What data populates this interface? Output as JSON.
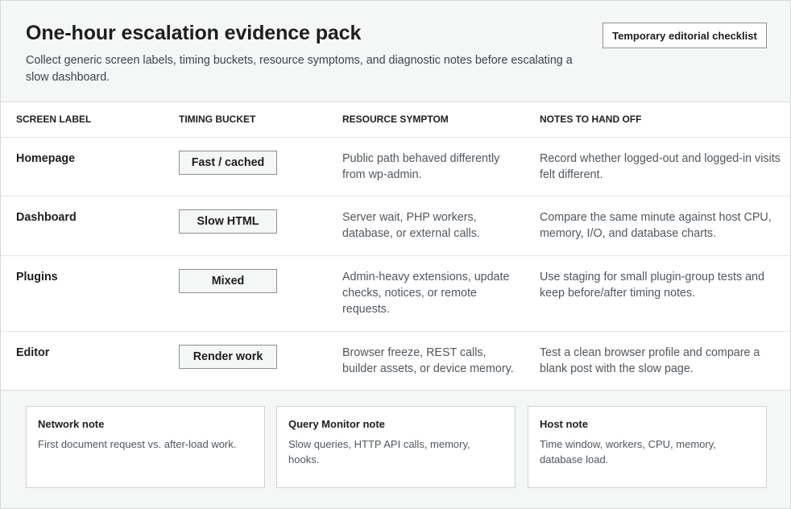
{
  "header": {
    "title": "One-hour escalation evidence pack",
    "subtitle": "Collect generic screen labels, timing buckets, resource symptoms, and diagnostic notes before escalating a slow dashboard.",
    "checklist_button": "Temporary editorial checklist"
  },
  "table": {
    "columns": [
      "SCREEN LABEL",
      "TIMING BUCKET",
      "RESOURCE SYMPTOM",
      "NOTES TO HAND OFF"
    ],
    "rows": [
      {
        "label": "Homepage",
        "bucket": "Fast / cached",
        "resource": "Public path behaved differently from wp-admin.",
        "notes": "Record whether logged-out and logged-in visits felt different."
      },
      {
        "label": "Dashboard",
        "bucket": "Slow HTML",
        "resource": "Server wait, PHP workers, database, or external calls.",
        "notes": "Compare the same minute against host CPU, memory, I/O, and database charts."
      },
      {
        "label": "Plugins",
        "bucket": "Mixed",
        "resource": "Admin-heavy extensions, update checks, notices, or remote requests.",
        "notes": "Use staging for small plugin-group tests and keep before/after timing notes."
      },
      {
        "label": "Editor",
        "bucket": "Render work",
        "resource": "Browser freeze, REST calls, builder assets, or device memory.",
        "notes": "Test a clean browser profile and compare a blank post with the slow page."
      }
    ]
  },
  "cards": [
    {
      "title": "Network note",
      "text": "First document request vs. after-load work."
    },
    {
      "title": "Query Monitor note",
      "text": "Slow queries, HTTP API calls, memory, hooks."
    },
    {
      "title": "Host note",
      "text": "Time window, workers, CPU, memory, database load."
    }
  ]
}
